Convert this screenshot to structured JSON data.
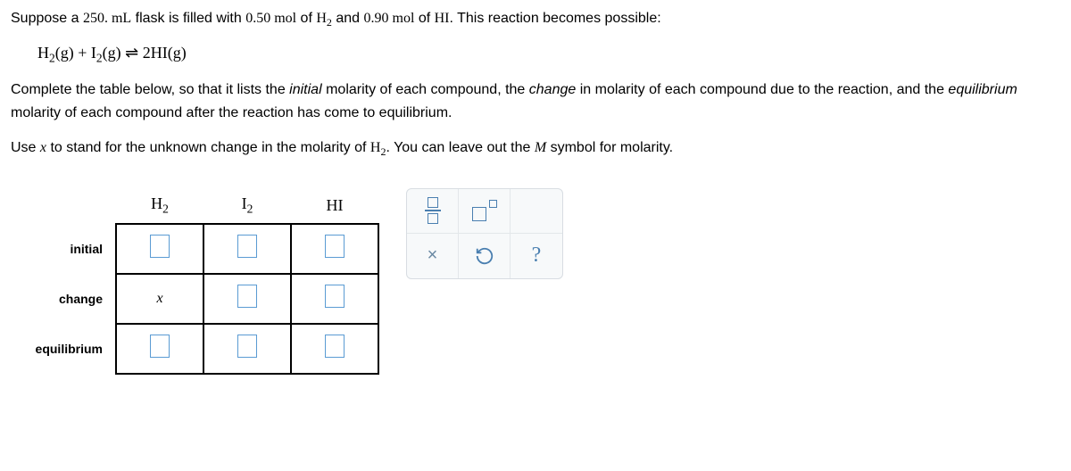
{
  "problem": {
    "line1_part1": "Suppose a ",
    "line1_volume": "250. mL",
    "line1_part2": " flask is filled with ",
    "line1_mol1": "0.50 mol",
    "line1_part3": " of ",
    "line1_species1": "H",
    "line1_species1_sub": "2",
    "line1_part4": " and ",
    "line1_mol2": "0.90 mol",
    "line1_part5": " of ",
    "line1_species2": "HI",
    "line1_part6": ". This reaction becomes possible:"
  },
  "equation": {
    "h2": "H",
    "h2_sub": "2",
    "g1": "(g)",
    "plus": " + ",
    "i2": "I",
    "i2_sub": "2",
    "g2": "(g)",
    "arrow": " ⇌ ",
    "coef": "2",
    "hi": "HI",
    "g3": "(g)"
  },
  "instructions": {
    "para2_part1": "Complete the table below, so that it lists the ",
    "para2_italic1": "initial",
    "para2_part2": " molarity of each compound, the ",
    "para2_italic2": "change",
    "para2_part3": " in molarity of each compound due to the reaction, and the ",
    "para2_italic3": "equilibrium",
    "para2_part4": " molarity of each compound after the reaction has come to equilibrium.",
    "para3_part1": "Use ",
    "para3_x": "x",
    "para3_part2": " to stand for the unknown change in the molarity of ",
    "para3_species": "H",
    "para3_species_sub": "2",
    "para3_part3": ". You can leave out the ",
    "para3_m": "M",
    "para3_part4": " symbol for molarity."
  },
  "table": {
    "headers": {
      "h2": "H",
      "h2_sub": "2",
      "i2": "I",
      "i2_sub": "2",
      "hi": "HI"
    },
    "rows": {
      "initial": "initial",
      "change": "change",
      "equilibrium": "equilibrium"
    },
    "change_h2": "x"
  },
  "toolbar": {
    "fraction": "fraction",
    "superscript": "superscript",
    "close": "×",
    "reset": "reset",
    "help": "?"
  }
}
